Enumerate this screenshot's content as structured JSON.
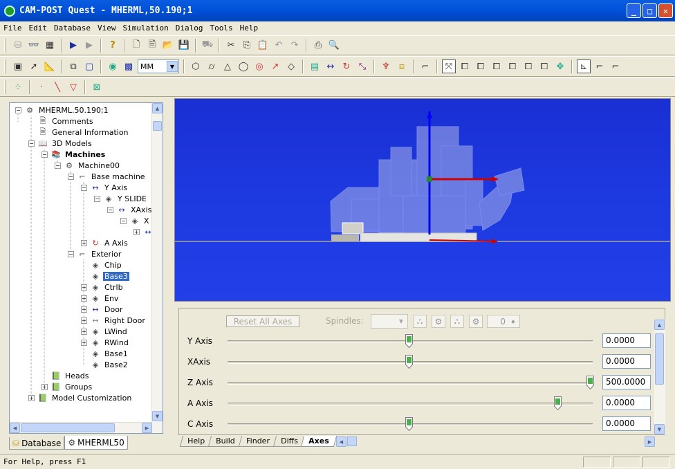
{
  "window": {
    "title": "CAM-POST Quest - MHERML,50.190;1"
  },
  "menu": [
    "File",
    "Edit",
    "Database",
    "View",
    "Simulation",
    "Dialog",
    "Tools",
    "Help"
  ],
  "toolbar": {
    "unit_value": "MM"
  },
  "tree": [
    {
      "label": "MHERML.50.190;1",
      "level": 0,
      "expander": "minus",
      "icon": "machine-icon"
    },
    {
      "label": "Comments",
      "level": 1,
      "expander": "none",
      "icon": "document-icon"
    },
    {
      "label": "General Information",
      "level": 1,
      "expander": "none",
      "icon": "document-icon"
    },
    {
      "label": "3D Models",
      "level": 1,
      "expander": "minus",
      "icon": "book-icon"
    },
    {
      "label": "Machines",
      "level": 2,
      "expander": "minus",
      "icon": "books-icon",
      "bold": true
    },
    {
      "label": "Machine00",
      "level": 3,
      "expander": "minus",
      "icon": "machine-icon"
    },
    {
      "label": "Base machine",
      "level": 4,
      "expander": "minus",
      "icon": "axes-icon"
    },
    {
      "label": "Y Axis",
      "level": 5,
      "expander": "minus",
      "icon": "linear-axis-icon"
    },
    {
      "label": "Y SLIDE",
      "level": 6,
      "expander": "minus",
      "icon": "component-icon"
    },
    {
      "label": "XAxis",
      "level": 7,
      "expander": "minus",
      "icon": "linear-axis-icon"
    },
    {
      "label": "X",
      "level": 8,
      "expander": "minus",
      "icon": "component-icon"
    },
    {
      "label": "",
      "level": 9,
      "expander": "plus",
      "icon": "linear-axis-icon"
    },
    {
      "label": "A Axis",
      "level": 5,
      "expander": "plus",
      "icon": "rotary-axis-icon"
    },
    {
      "label": "Exterior",
      "level": 4,
      "expander": "minus",
      "icon": "axes-icon"
    },
    {
      "label": "Chip",
      "level": 5,
      "expander": "none",
      "icon": "component-icon"
    },
    {
      "label": "Base3",
      "level": 5,
      "expander": "none",
      "icon": "component-icon",
      "selected": true
    },
    {
      "label": "Ctrlb",
      "level": 5,
      "expander": "plus",
      "icon": "component-icon"
    },
    {
      "label": "Env",
      "level": 5,
      "expander": "plus",
      "icon": "component-icon"
    },
    {
      "label": "Door",
      "level": 5,
      "expander": "plus",
      "icon": "linear-axis-icon"
    },
    {
      "label": "Right Door",
      "level": 5,
      "expander": "plus",
      "icon": "gray-axis-icon"
    },
    {
      "label": "LWind",
      "level": 5,
      "expander": "plus",
      "icon": "component-icon"
    },
    {
      "label": "RWind",
      "level": 5,
      "expander": "plus",
      "icon": "component-icon"
    },
    {
      "label": "Base1",
      "level": 5,
      "expander": "none",
      "icon": "component-icon"
    },
    {
      "label": "Base2",
      "level": 5,
      "expander": "none",
      "icon": "component-icon"
    },
    {
      "label": "Heads",
      "level": 2,
      "expander": "none",
      "icon": "green-books-icon"
    },
    {
      "label": "Groups",
      "level": 2,
      "expander": "plus",
      "icon": "green-books-icon"
    },
    {
      "label": "Model Customization",
      "level": 1,
      "expander": "plus",
      "icon": "green-books-icon"
    }
  ],
  "left_tabs": [
    {
      "label": "Database",
      "icon": "database-icon",
      "active": false
    },
    {
      "label": "MHERML50",
      "icon": "machine-icon",
      "active": true
    }
  ],
  "axes_panel": {
    "reset_label": "Reset All Axes",
    "spindles_label": "Spindles:",
    "spindle_count": "0",
    "axes": [
      {
        "label": "Y Axis",
        "value": "0.0000",
        "slider": 0.5
      },
      {
        "label": "XAxis",
        "value": "0.0000",
        "slider": 0.5
      },
      {
        "label": "Z Axis",
        "value": "500.0000",
        "slider": 1.0
      },
      {
        "label": "A Axis",
        "value": "0.0000",
        "slider": 0.911
      },
      {
        "label": "C Axis",
        "value": "0.0000",
        "slider": 0.5
      }
    ]
  },
  "bottom_tabs": [
    {
      "label": "Help",
      "active": false
    },
    {
      "label": "Build",
      "active": false
    },
    {
      "label": "Finder",
      "active": false
    },
    {
      "label": "Diffs",
      "active": false
    },
    {
      "label": "Axes",
      "active": true
    }
  ],
  "status": {
    "text": "For Help, press F1"
  },
  "colors": {
    "titlebar": "#0a5ce0",
    "viewport": "#1d3ae0",
    "selection": "#316ac5",
    "axis_blue": "#0000ff",
    "axis_red": "#cc0000"
  }
}
